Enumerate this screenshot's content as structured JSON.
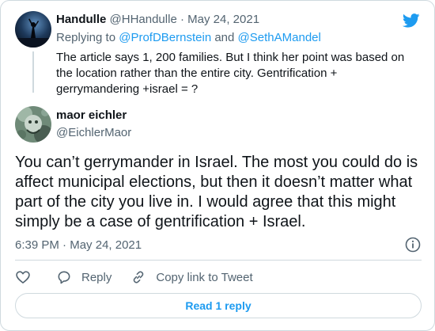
{
  "parent_tweet": {
    "display_name": "Handulle",
    "handle": "@HHandulle",
    "separator": " · ",
    "date": "May 24, 2021",
    "replying_prefix": "Replying to ",
    "replying_user_1": "@ProfDBernstein",
    "replying_and": " and ",
    "replying_user_2": "@SethAMandel",
    "text": "The article says 1, 200 families. But I think her point was based on the location rather than the entire city. Gentrification + gerrymandering +israel = ?"
  },
  "tweet": {
    "display_name": "maor eichler",
    "handle": "@EichlerMaor",
    "text": "You can’t gerrymander in Israel. The most you could do is affect municipal elections, but then it doesn’t matter what part of the city you live in. I would agree that this might simply be a case of gentrification + Israel.",
    "time": "6:39 PM",
    "separator": " · ",
    "date": "May 24, 2021"
  },
  "actions": {
    "like_icon": "heart-icon",
    "reply_label": "Reply",
    "reply_icon": "speech-bubble-icon",
    "copy_label": "Copy link to Tweet",
    "copy_icon": "link-icon"
  },
  "read_replies_label": "Read 1 reply",
  "icons": {
    "brand": "twitter-bird-icon",
    "info": "info-icon"
  },
  "colors": {
    "accent": "#1d9bf0",
    "text": "#0f1419",
    "secondary": "#536471",
    "border": "#cfd9de"
  }
}
